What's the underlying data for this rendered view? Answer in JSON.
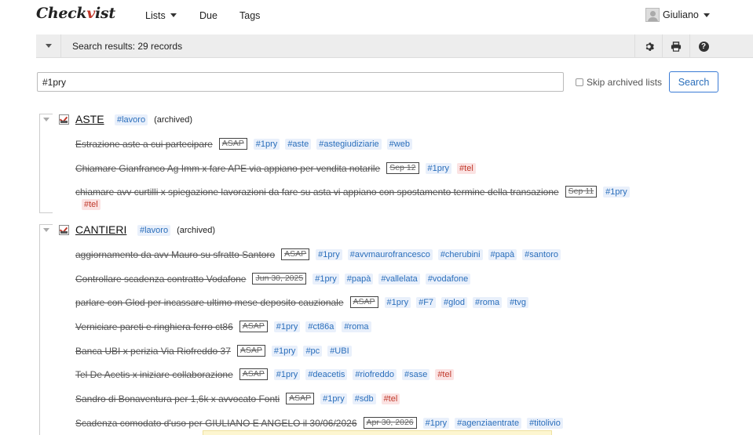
{
  "header": {
    "logo": "Checkvist",
    "nav": {
      "lists": "Lists",
      "due": "Due",
      "tags": "Tags"
    },
    "user_name": "Giuliano"
  },
  "toolbar": {
    "title": "Search results: 29 records",
    "icons": [
      "gear-icon",
      "print-icon",
      "help-icon"
    ],
    "help_glyph": "?"
  },
  "search": {
    "value": "#1pry",
    "skip_archived_label": "Skip archived lists",
    "button_label": "Search"
  },
  "groups": [
    {
      "title": "ASTE",
      "tag": "#lavoro",
      "status": "(archived)",
      "tasks": [
        {
          "text": "Estrazione aste a cui partecipare",
          "date": "ASAP",
          "tags": [
            "#1pry",
            "#aste",
            "#astegiudiziarie",
            "#web"
          ],
          "red_tags": []
        },
        {
          "text": "Chiamare Gianfranco Ag Imm x fare APE via appiano per vendita notarile",
          "date": "Sep 12",
          "tags": [
            "#1pry"
          ],
          "red_tags": [
            "#tel"
          ]
        },
        {
          "text": "chiamare avv curtilli x spiegazione lavorazioni da fare su asta vi appiano con spostamento termine della transazione",
          "date": "Sep 11",
          "tags": [
            "#1pry"
          ],
          "red_tags": [
            "#tel"
          ]
        }
      ]
    },
    {
      "title": "CANTIERI",
      "tag": "#lavoro",
      "status": "(archived)",
      "tasks": [
        {
          "text": "aggiornamento da avv Mauro su sfratto Santoro",
          "date": "ASAP",
          "tags": [
            "#1pry",
            "#avvmaurofrancesco",
            "#cherubini",
            "#papà",
            "#santoro"
          ],
          "red_tags": []
        },
        {
          "text": "Controllare scadenza contratto Vodafone",
          "date": "Jun 30, 2025",
          "tags": [
            "#1pry",
            "#papà",
            "#vallelata",
            "#vodafone"
          ],
          "red_tags": []
        },
        {
          "text": "parlare con Glod per incassare ultimo mese deposito cauzionale",
          "date": "ASAP",
          "tags": [
            "#1pry",
            "#F7",
            "#glod",
            "#roma",
            "#tvg"
          ],
          "red_tags": []
        },
        {
          "text": "Verniciare pareti e ringhiera ferro ct86",
          "date": "ASAP",
          "tags": [
            "#1pry",
            "#ct86a",
            "#roma"
          ],
          "red_tags": []
        },
        {
          "text": "Banca UBI x perizia Via Riofreddo 37",
          "date": "ASAP",
          "tags": [
            "#1pry",
            "#pc",
            "#UBI"
          ],
          "red_tags": []
        },
        {
          "text": "Tel De Acetis x iniziare collaborazione",
          "date": "ASAP",
          "tags": [
            "#1pry",
            "#deacetis",
            "#riofreddo",
            "#sase"
          ],
          "red_tags": [
            "#tel"
          ]
        },
        {
          "text": "Sandro di Bonaventura per 1,6k x avvocato Fonti",
          "date": "ASAP",
          "tags": [
            "#1pry",
            "#sdb"
          ],
          "red_tags": [
            "#tel"
          ]
        },
        {
          "text": "Scadenza comodato d'uso per GIULIANO E ANGELO il 30/06/2026",
          "date": "Apr 30, 2026",
          "tags": [
            "#1pry",
            "#agenziaentrate",
            "#titolivio"
          ],
          "red_tags": []
        }
      ]
    }
  ]
}
